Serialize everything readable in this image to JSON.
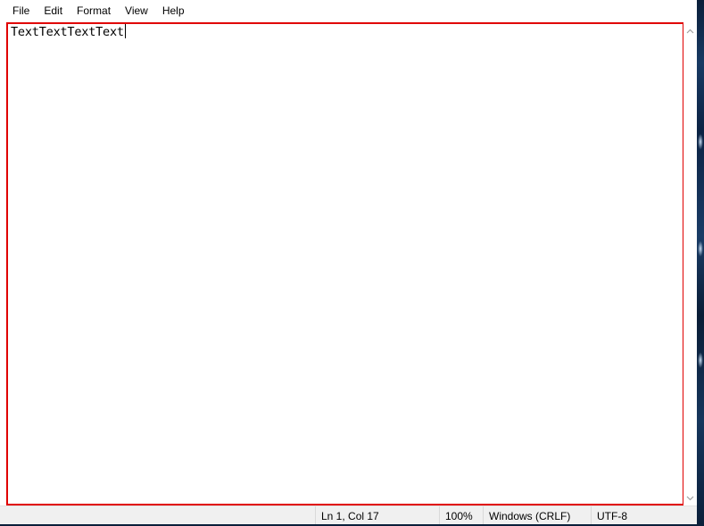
{
  "menubar": {
    "items": [
      {
        "label": "File"
      },
      {
        "label": "Edit"
      },
      {
        "label": "Format"
      },
      {
        "label": "View"
      },
      {
        "label": "Help"
      }
    ]
  },
  "editor": {
    "content": "TextTextTextText",
    "highlight_color": "#e00000"
  },
  "scrollbar": {
    "up_icon": "chevron-up-icon",
    "down_icon": "chevron-down-icon"
  },
  "statusbar": {
    "position": "Ln 1, Col 17",
    "zoom": "100%",
    "line_ending": "Windows (CRLF)",
    "encoding": "UTF-8"
  }
}
